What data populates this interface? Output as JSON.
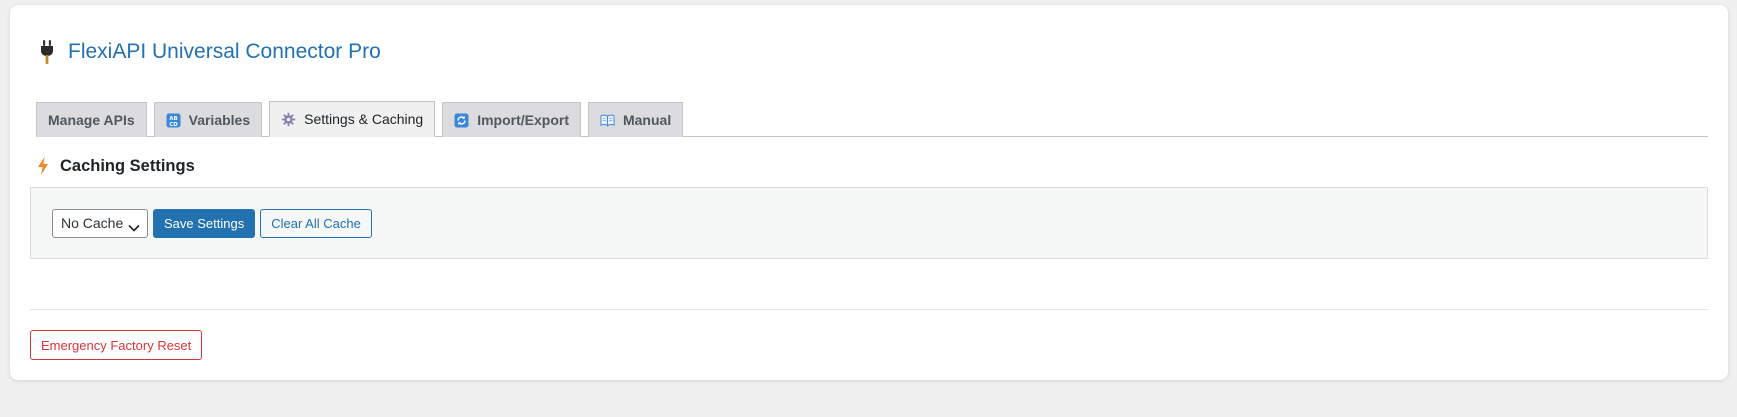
{
  "header": {
    "title": "FlexiAPI Universal Connector Pro",
    "icon": "plug-icon"
  },
  "tabs": [
    {
      "label": "Manage APIs",
      "icon": "",
      "active": false
    },
    {
      "label": "Variables",
      "icon": "abcd-icon",
      "active": false
    },
    {
      "label": "Settings & Caching",
      "icon": "gear-icon",
      "active": true
    },
    {
      "label": "Import/Export",
      "icon": "refresh-icon",
      "active": false
    },
    {
      "label": "Manual",
      "icon": "book-icon",
      "active": false
    }
  ],
  "section": {
    "title": "Caching Settings",
    "icon": "lightning-icon"
  },
  "cache_form": {
    "select_value": "No Cache",
    "save_label": "Save Settings",
    "clear_label": "Clear All Cache"
  },
  "danger": {
    "reset_label": "Emergency Factory Reset"
  },
  "colors": {
    "accent": "#2271b1",
    "danger": "#d63638",
    "bolt": "#f08a24"
  }
}
